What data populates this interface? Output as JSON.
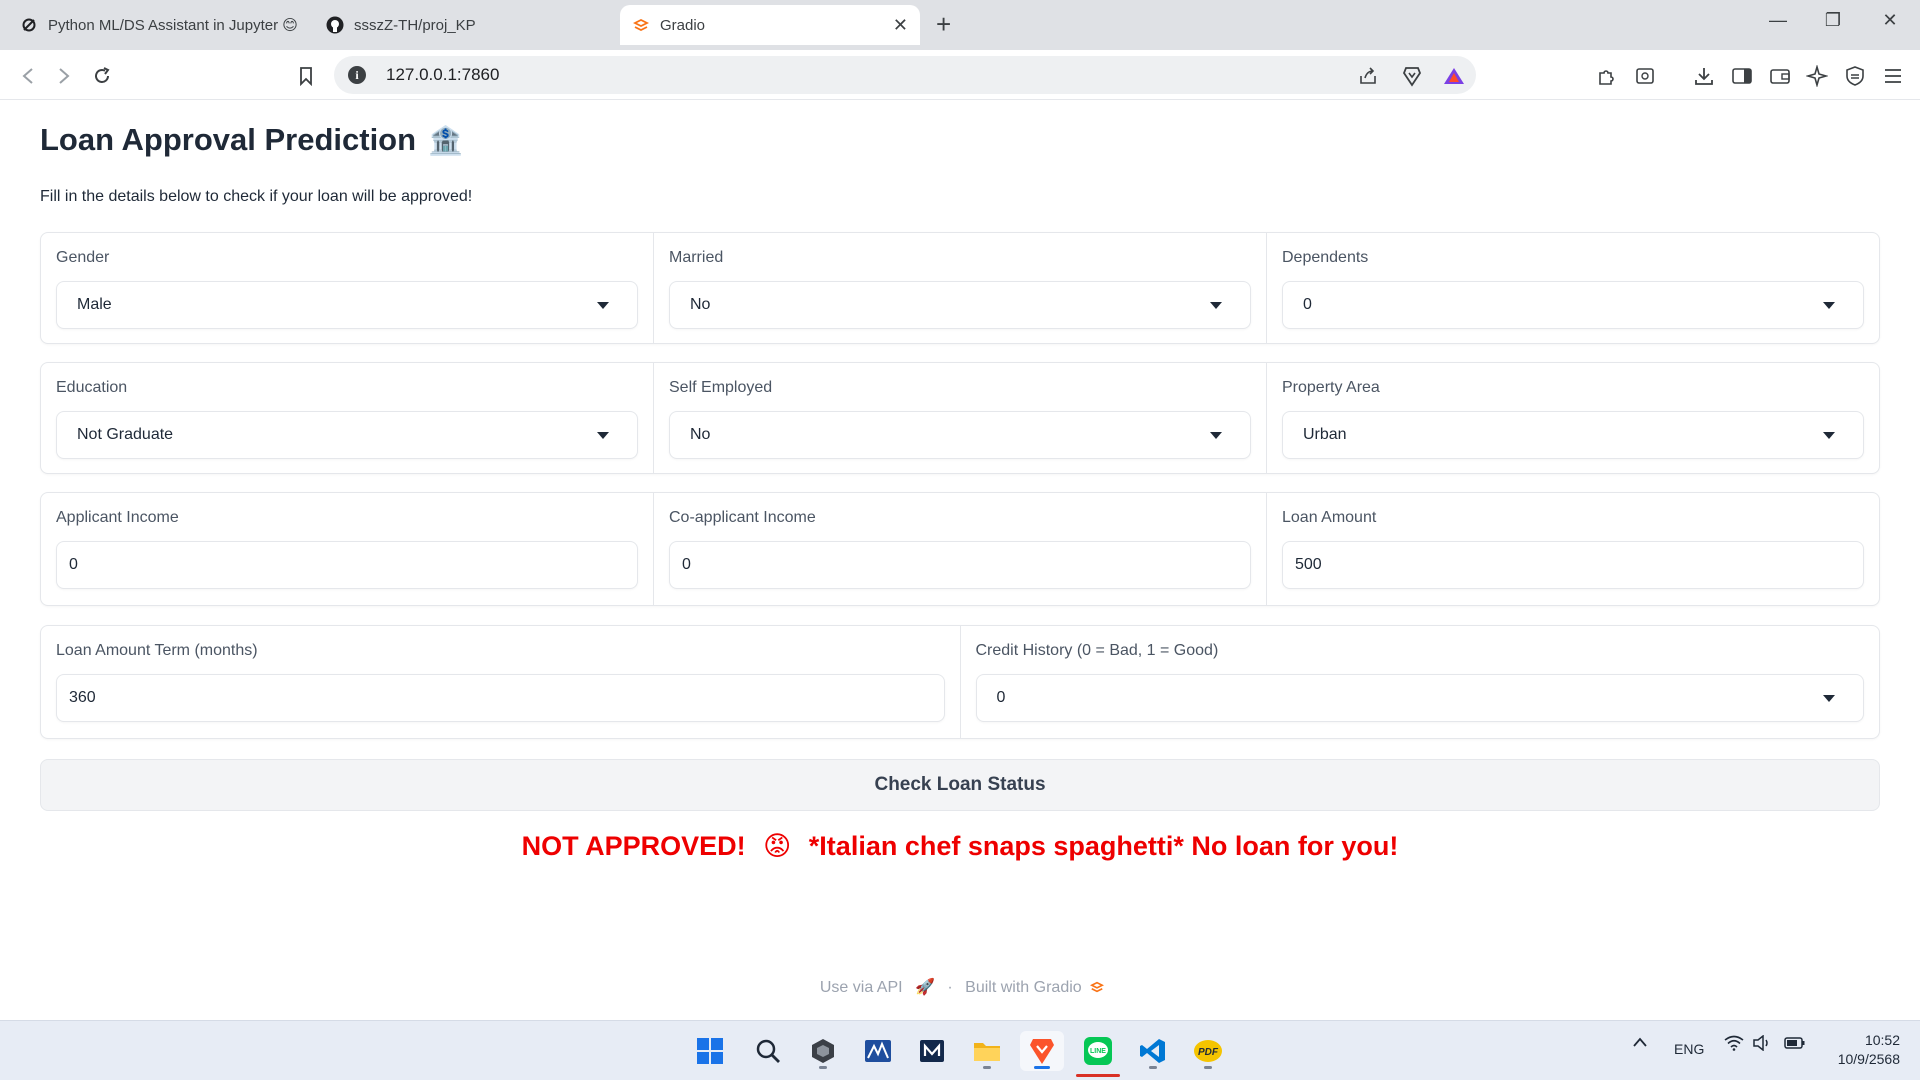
{
  "browser": {
    "tabs": [
      {
        "label": "Python ML/DS Assistant in Jupyter 😊",
        "icon": "jupyter-icon"
      },
      {
        "label": "ssszZ-TH/proj_KP",
        "icon": "github-icon"
      },
      {
        "label": "Gradio",
        "icon": "gradio-icon",
        "active": true
      }
    ],
    "url": "127.0.0.1:7860"
  },
  "app": {
    "title": "Loan Approval Prediction",
    "title_emoji": "🏦",
    "subtitle": "Fill in the details below to check if your loan will be approved!",
    "rows": [
      [
        {
          "label": "Gender",
          "value": "Male",
          "type": "dropdown"
        },
        {
          "label": "Married",
          "value": "No",
          "type": "dropdown"
        },
        {
          "label": "Dependents",
          "value": "0",
          "type": "dropdown"
        }
      ],
      [
        {
          "label": "Education",
          "value": "Not Graduate",
          "type": "dropdown"
        },
        {
          "label": "Self Employed",
          "value": "No",
          "type": "dropdown"
        },
        {
          "label": "Property Area",
          "value": "Urban",
          "type": "dropdown"
        }
      ],
      [
        {
          "label": "Applicant Income",
          "value": "0",
          "type": "number"
        },
        {
          "label": "Co-applicant Income",
          "value": "0",
          "type": "number"
        },
        {
          "label": "Loan Amount",
          "value": "500",
          "type": "number"
        }
      ],
      [
        {
          "label": "Loan Amount Term (months)",
          "value": "360",
          "type": "number"
        },
        {
          "label": "Credit History (0 = Bad, 1 = Good)",
          "value": "0",
          "type": "dropdown"
        }
      ]
    ],
    "button_label": "Check Loan Status",
    "result": {
      "prefix": "NOT APPROVED!",
      "emoji": "😡",
      "message": "*Italian chef snaps spaghetti* No loan for you!",
      "color": "#ee0000"
    },
    "footer": {
      "api_label": "Use via API",
      "separator": "·",
      "built_label": "Built with Gradio"
    }
  },
  "taskbar": {
    "tray_lang": "ENG",
    "time": "10:52",
    "date": "10/9/2568"
  }
}
